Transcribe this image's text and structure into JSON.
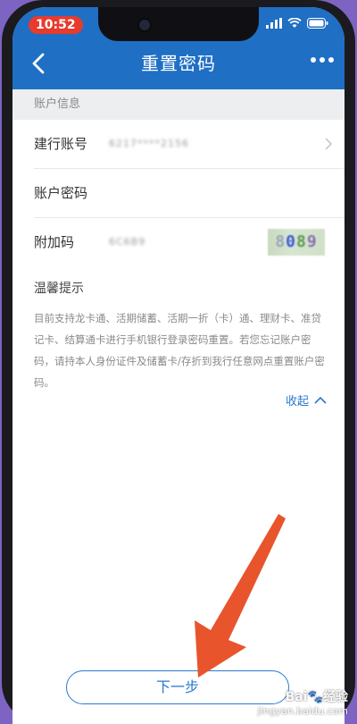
{
  "status_bar": {
    "time": "10:52",
    "icons": [
      "signal-icon",
      "wifi-icon",
      "battery-icon"
    ]
  },
  "nav": {
    "title": "重置密码",
    "back_icon": "chevron-left-icon",
    "more_icon": "more-dots-icon"
  },
  "section": {
    "title": "账户信息"
  },
  "form": {
    "account": {
      "label": "建行账号",
      "value": "6217****2156"
    },
    "password": {
      "label": "账户密码",
      "value": ""
    },
    "extra_code": {
      "label": "附加码",
      "value": "6C6B9",
      "captcha": "8089"
    }
  },
  "tips": {
    "title": "温馨提示",
    "text": "目前支持龙卡通、活期储蓄、活期一折（卡）通、理财卡、准贷记卡、结算通卡进行手机银行登录密码重置。若您忘记账户密码，请持本人身份证件及储蓄卡/存折到我行任意网点重置账户密码。",
    "collapse_label": "收起"
  },
  "actions": {
    "next_label": "下一步"
  },
  "watermark": {
    "brand": "Bai",
    "brand_suffix": "经验",
    "url": "jingyan.baidu.com"
  },
  "colors": {
    "header_blue": "#1f6fc4",
    "accent_blue": "#2b79d0",
    "annotation_arrow": "#e8542c",
    "status_time_bg": "#e63b2e"
  }
}
